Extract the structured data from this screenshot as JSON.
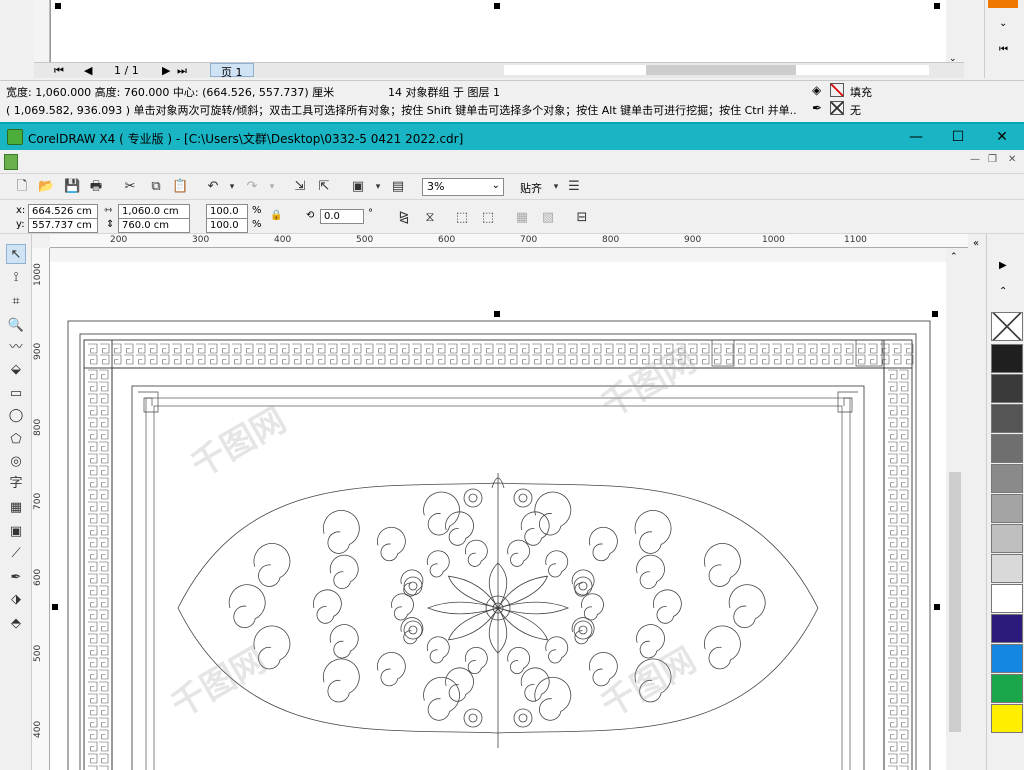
{
  "prev_window": {
    "page_counter": "1 / 1",
    "page_tab": "页 1",
    "status_line1": {
      "dimensions": "宽度: 1,060.000  高度: 760.000  中心: (664.526, 557.737)  厘米",
      "object_info": "14 对象群组 于 图层 1",
      "fill_label": "填充"
    },
    "status_line2": {
      "hint": "( 1,069.582, 936.093 ) 单击对象两次可旋转/倾斜；双击工具可选择所有对象；按住 Shift 键单击可选择多个对象；按住 Alt 键单击可进行挖掘；按住 Ctrl 并单...",
      "outline_label": "无"
    }
  },
  "window": {
    "title": "CorelDRAW X4 ( 专业版 ) - [C:\\Users\\文群\\Desktop\\0332-5 0421 2022.cdr]",
    "minimize": "—",
    "maximize": "☐",
    "close": "✕"
  },
  "toolbar": {
    "zoom": "3%",
    "snap_label": "贴齐"
  },
  "property_bar": {
    "x_label": "x:",
    "y_label": "y:",
    "x_value": "664.526 cm",
    "y_value": "557.737 cm",
    "width_value": "1,060.0 cm",
    "height_value": "760.0 cm",
    "scale_x": "100.0",
    "scale_y": "100.0",
    "percent": "%",
    "rotation": "0.0",
    "degree": "°"
  },
  "ruler": {
    "h_ticks": [
      "200",
      "300",
      "400",
      "500",
      "600",
      "700",
      "800",
      "900",
      "1000",
      "1100"
    ],
    "v_ticks": [
      "1000",
      "900",
      "800",
      "700",
      "600",
      "500",
      "400"
    ]
  },
  "palette": {
    "colors": [
      "#1f1f1f",
      "#3a3a3a",
      "#555555",
      "#6f6f6f",
      "#8a8a8a",
      "#a4a4a4",
      "#bfbfbf",
      "#d9d9d9",
      "#ffffff",
      "#2e1a7a",
      "#1687e0",
      "#1aa64a",
      "#ffee00"
    ]
  },
  "watermark": "千图网"
}
